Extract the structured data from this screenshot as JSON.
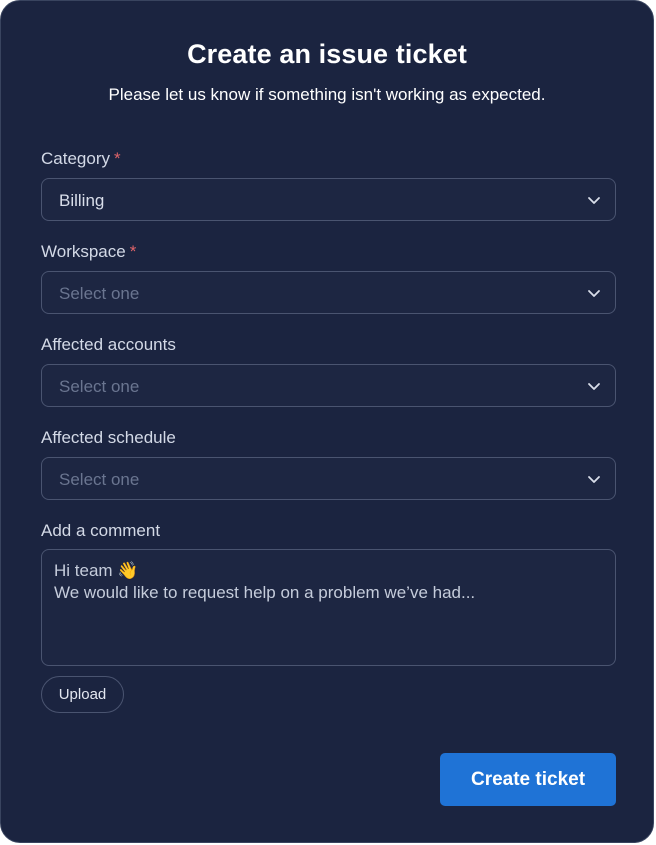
{
  "header": {
    "title": "Create an issue ticket",
    "subtitle": "Please let us know if something isn't working as expected."
  },
  "form": {
    "category": {
      "label": "Category",
      "required_mark": "*",
      "value": "Billing"
    },
    "workspace": {
      "label": "Workspace",
      "required_mark": "*",
      "placeholder": "Select one"
    },
    "affected_accounts": {
      "label": "Affected accounts",
      "placeholder": "Select one"
    },
    "affected_schedule": {
      "label": "Affected schedule",
      "placeholder": "Select one"
    },
    "comment": {
      "label": "Add a comment",
      "line1": "Hi team 👋",
      "line2": "We would like to request help on a problem we’ve had..."
    },
    "upload_label": "Upload",
    "submit_label": "Create ticket"
  },
  "colors": {
    "card_bg": "#1b2440",
    "accent": "#1f73d6",
    "required": "#e0646a"
  },
  "icons": {
    "select_caret": "chevron-down-icon"
  }
}
